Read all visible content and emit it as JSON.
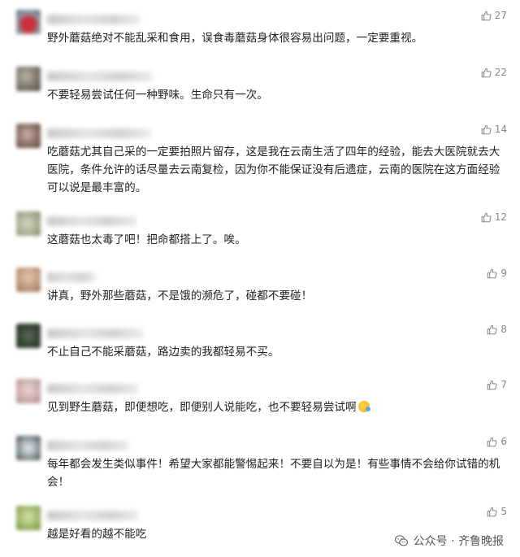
{
  "comments": [
    {
      "likes": "27",
      "text": "野外蘑菇绝对不能乱采和食用，误食毒蘑菇身体很容易出问题，一定要重视。"
    },
    {
      "likes": "22",
      "text": "不要轻易尝试任何一种野味。生命只有一次。"
    },
    {
      "likes": "14",
      "text": "吃蘑菇尤其自己采的一定要拍照片留存，这是我在云南生活了四年的经验，能去大医院就去大医院，条件允许的话尽量去云南复检，因为你不能保证没有后遗症，云南的医院在这方面经验可以说是最丰富的。"
    },
    {
      "likes": "12",
      "text": "这蘑菇也太毒了吧！把命都搭上了。唉。"
    },
    {
      "likes": "9",
      "text": "讲真，野外那些蘑菇，不是饿的濒危了，碰都不要碰！"
    },
    {
      "likes": "8",
      "text": "不止自己不能采蘑菇，路边卖的我都轻易不买。"
    },
    {
      "likes": "7",
      "text": "见到野生蘑菇，即便想吃，即便别人说能吃，也不要轻易尝试啊"
    },
    {
      "likes": "6",
      "text": "每年都会发生类似事件！希望大家都能警惕起来！不要自以为是！有些事情不会给你试错的机会！"
    },
    {
      "likes": "5",
      "text": "越是好看的越不能吃"
    }
  ],
  "watermark": {
    "text": "公众号 · 齐鲁晚报"
  },
  "icons": {
    "like": "thumb-up-icon",
    "emoji": "sweat-smile-emoji-icon",
    "watermark": "wechat-icon"
  },
  "colors": {
    "meta": "#888888",
    "text": "#1f1f1f"
  }
}
